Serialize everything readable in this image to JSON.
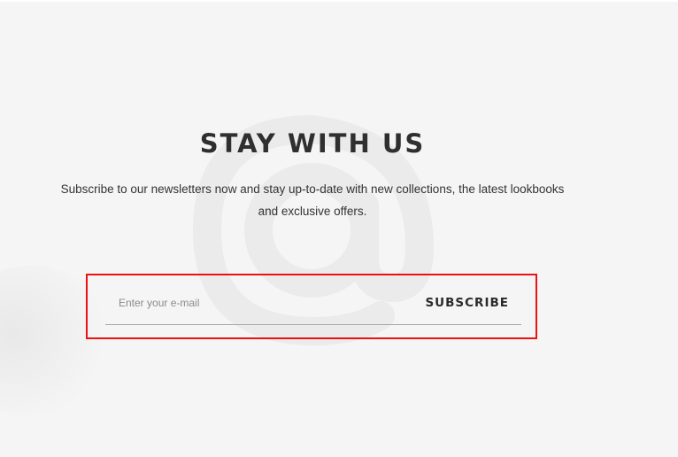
{
  "newsletter": {
    "title": "STAY WITH US",
    "description": "Subscribe to our newsletters now and stay up-to-date with new collections, the latest lookbooks and exclusive offers.",
    "email_placeholder": "Enter your e-mail",
    "subscribe_label": "SUBSCRIBE",
    "watermark_icon": "at-sign-icon"
  },
  "colors": {
    "background": "#f5f5f5",
    "title": "#2f2f2f",
    "text": "#333333",
    "highlight_border": "#ee1111",
    "underline": "#a9a9a9"
  }
}
